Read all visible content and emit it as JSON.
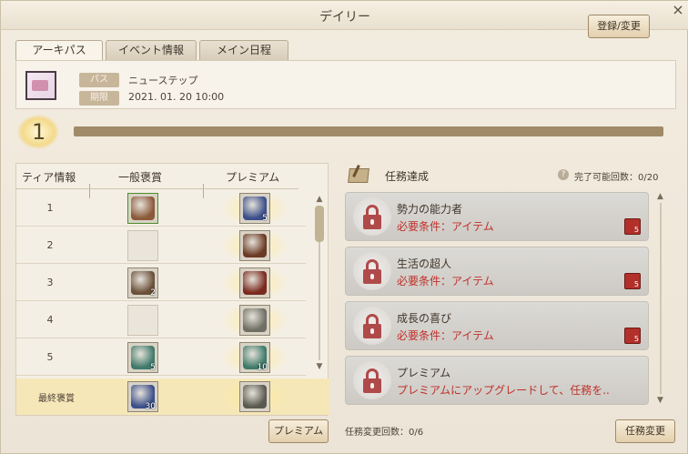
{
  "window": {
    "title": "デイリー",
    "close_glyph": "×"
  },
  "tabs": [
    {
      "label": "アーキパス",
      "active": true
    },
    {
      "label": "イベント情報",
      "active": false
    },
    {
      "label": "メイン日程",
      "active": false
    }
  ],
  "pass": {
    "pass_label": "パス",
    "pass_value": "ニューステップ",
    "period_label": "期限",
    "period_value": "2021. 01. 20 10:00",
    "register_button": "登録/変更"
  },
  "level": {
    "current": "1",
    "progress": 0.0
  },
  "tier_table": {
    "headers": [
      "ティア情報",
      "一般褒賞",
      "プレミアム"
    ],
    "rows": [
      {
        "tier": "1",
        "normal": {
          "icon": "treasure-chest-icon",
          "count": "",
          "border": "green",
          "color": "#8b5a3a"
        },
        "premium": {
          "icon": "blue-orb-icon",
          "count": "5",
          "color": "#3b4f8a"
        }
      },
      {
        "tier": "2",
        "normal": null,
        "premium": {
          "icon": "fire-crystal-icon",
          "count": "",
          "color": "#6b3a24"
        }
      },
      {
        "tier": "3",
        "normal": {
          "icon": "food-plate-icon",
          "count": "2",
          "border": "",
          "color": "#6b4f3a"
        },
        "premium": {
          "icon": "red-chest-icon",
          "count": "",
          "color": "#7a2a1e"
        }
      },
      {
        "tier": "4",
        "normal": null,
        "premium": {
          "icon": "metal-chest-icon",
          "count": "",
          "color": "#6f6f64"
        }
      },
      {
        "tier": "5",
        "normal": {
          "icon": "green-crystal-icon",
          "count": "5",
          "border": "",
          "color": "#3f7a6a"
        },
        "premium": {
          "icon": "green-crystal-icon",
          "count": "10",
          "color": "#3f7a6a"
        }
      }
    ],
    "final": {
      "label": "最終褒賞",
      "normal": {
        "icon": "blue-orb-icon",
        "count": "30",
        "color": "#3b4f8a"
      },
      "premium": {
        "icon": "dragon-head-icon",
        "count": "",
        "color": "#5a5a50"
      }
    },
    "premium_button": "プレミアム",
    "scroll_up": "▲",
    "scroll_down": "▼"
  },
  "missions": {
    "title": "任務達成",
    "help_glyph": "?",
    "complete_count": "完了可能回数：0/20",
    "items": [
      {
        "name": "勢力の能力者",
        "requirement": "必要条件：アイテム",
        "reward_count": "5"
      },
      {
        "name": "生活の超人",
        "requirement": "必要条件：アイテム",
        "reward_count": "5"
      },
      {
        "name": "成長の喜び",
        "requirement": "必要条件：アイテム",
        "reward_count": "5"
      },
      {
        "name": "プレミアム",
        "requirement": "プレミアムにアップグレードして、任務を..",
        "reward_count": ""
      }
    ],
    "change_count": "任務変更回数：0/6",
    "change_button": "任務変更",
    "scroll_up": "▲",
    "scroll_down": "▼"
  }
}
